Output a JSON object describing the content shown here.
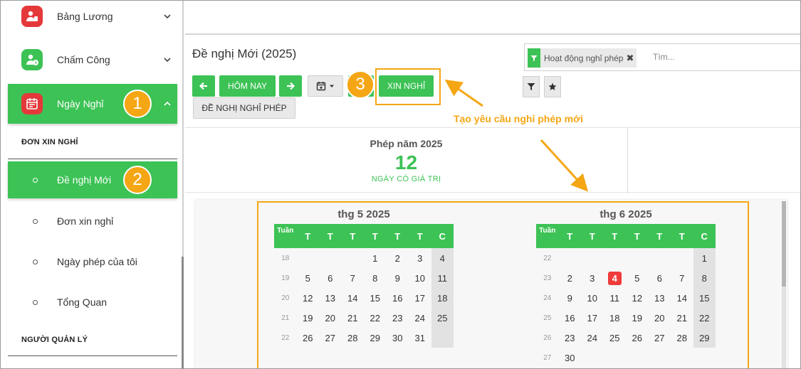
{
  "sidebar": {
    "menu": [
      {
        "label": "Bảng Lương",
        "icon": "payroll-icon",
        "icon_bg": "#e5383b"
      },
      {
        "label": "Chấm Công",
        "icon": "attendance-icon",
        "icon_bg": "#3cc255"
      },
      {
        "label": "Ngày Nghỉ",
        "icon": "calendar-icon",
        "icon_bg": "#e5383b"
      }
    ],
    "section1": "ĐƠN XIN NGHỈ",
    "sub_items": [
      "Đề nghị Mới",
      "Đơn xin nghỉ",
      "Ngày phép của tôi",
      "Tổng Quan"
    ],
    "section2": "NGƯỜI QUẢN LÝ"
  },
  "badges": [
    "1",
    "2",
    "3"
  ],
  "main": {
    "title": "Đề nghị Mới (2025)",
    "buttons": {
      "today": "HÔM NAY",
      "request_leave": "XIN NGHỈ",
      "propose_leave": "ĐỀ NGHỊ NGHỈ PHÉP"
    },
    "search": {
      "facet": "Hoạt động nghỉ phép",
      "placeholder": "Tìm..."
    },
    "annotation": "Tạo yêu cầu nghỉ phép mới",
    "stat": {
      "title": "Phép năm 2025",
      "value": "12",
      "unit": "NGÀY CÓ GIÁ TRỊ"
    }
  },
  "calendar": {
    "week_label": "Tuần",
    "day_headers": [
      "T",
      "T",
      "T",
      "T",
      "T",
      "T",
      "C"
    ],
    "months": [
      {
        "title": "thg 5 2025",
        "weeks": [
          {
            "wk": "18",
            "days": [
              "",
              "",
              "",
              "1",
              "2",
              "3",
              "4"
            ]
          },
          {
            "wk": "19",
            "days": [
              "5",
              "6",
              "7",
              "8",
              "9",
              "10",
              "11"
            ]
          },
          {
            "wk": "20",
            "days": [
              "12",
              "13",
              "14",
              "15",
              "16",
              "17",
              "18"
            ]
          },
          {
            "wk": "21",
            "days": [
              "19",
              "20",
              "21",
              "22",
              "23",
              "24",
              "25"
            ]
          },
          {
            "wk": "22",
            "days": [
              "26",
              "27",
              "28",
              "29",
              "30",
              "31",
              ""
            ]
          }
        ]
      },
      {
        "title": "thg 6 2025",
        "weeks": [
          {
            "wk": "22",
            "days": [
              "",
              "",
              "",
              "",
              "",
              "",
              "1"
            ]
          },
          {
            "wk": "23",
            "days": [
              "2",
              "3",
              "4",
              "5",
              "6",
              "7",
              "8"
            ]
          },
          {
            "wk": "24",
            "days": [
              "9",
              "10",
              "11",
              "12",
              "13",
              "14",
              "15"
            ]
          },
          {
            "wk": "25",
            "days": [
              "16",
              "17",
              "18",
              "19",
              "20",
              "21",
              "22"
            ]
          },
          {
            "wk": "26",
            "days": [
              "23",
              "24",
              "25",
              "26",
              "27",
              "28",
              "29"
            ]
          },
          {
            "wk": "27",
            "days": [
              "30",
              "",
              "",
              "",
              "",
              "",
              ""
            ]
          }
        ],
        "today": "4"
      }
    ]
  },
  "colors": {
    "accent": "#3cc255",
    "highlight": "#f5a614",
    "today": "#f03b3b"
  }
}
